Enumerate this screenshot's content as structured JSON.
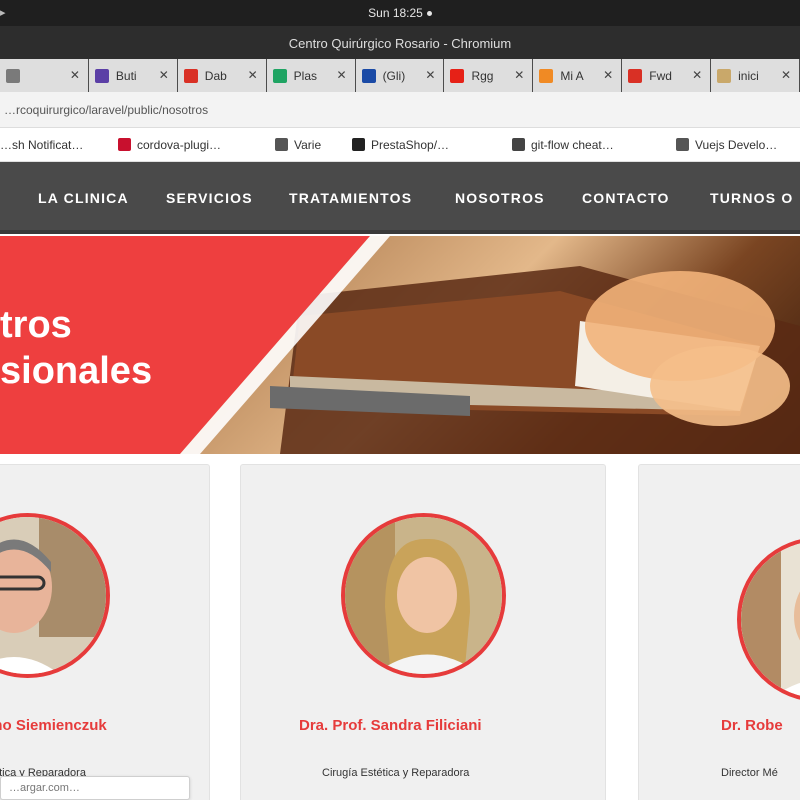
{
  "system": {
    "clock": "Sun 18:25"
  },
  "window": {
    "title": "Centro Quirúrgico Rosario - Chromium"
  },
  "tabs": [
    {
      "label": "",
      "favicon_color": "#7a7a7a"
    },
    {
      "label": "Buti",
      "favicon_color": "#5b3fa6"
    },
    {
      "label": "Dab",
      "favicon_color": "#d93025"
    },
    {
      "label": "Plas",
      "favicon_color": "#1fa463"
    },
    {
      "label": "(Gli)",
      "favicon_color": "#1a4aa6"
    },
    {
      "label": "Rgg",
      "favicon_color": "#e62117"
    },
    {
      "label": "Mi A",
      "favicon_color": "#f08a24"
    },
    {
      "label": "Fwd",
      "favicon_color": "#d93025"
    },
    {
      "label": "inici",
      "favicon_color": "#c9a86a"
    }
  ],
  "address_bar": {
    "url": "…rcoquirurgico/laravel/public/nosotros"
  },
  "bookmarks": [
    {
      "label": "…sh Notificat…",
      "icon_color": "#ffffff"
    },
    {
      "label": "cordova-plugi…",
      "icon_color": "#c8102e"
    },
    {
      "label": "Varie",
      "icon_color": "#555555"
    },
    {
      "label": "PrestaShop/…",
      "icon_color": "#222222"
    },
    {
      "label": "git-flow cheat…",
      "icon_color": "#444444"
    },
    {
      "label": "Vuejs Develo…",
      "icon_color": "#555555"
    }
  ],
  "site_nav": [
    "LA CLINICA",
    "SERVICIOS",
    "TRATAMIENTOS",
    "NOSOTROS",
    "CONTACTO",
    "TURNOS O"
  ],
  "hero": {
    "line1": "tros",
    "line2": "sionales",
    "accent_color": "#ee3f3f"
  },
  "professionals": [
    {
      "name": "ermo Siemienczuk",
      "specialty": "ética y Reparadora"
    },
    {
      "name": "Dra. Prof. Sandra Filiciani",
      "specialty": "Cirugía Estética y Reparadora"
    },
    {
      "name": "Dr. Robe",
      "specialty": "Director Mé"
    }
  ],
  "search_suggest": {
    "text": "…argar.com…"
  },
  "colors": {
    "nav_bg": "#4a4a4a",
    "accent": "#e63b3b",
    "card_bg": "#f0f0f0"
  }
}
